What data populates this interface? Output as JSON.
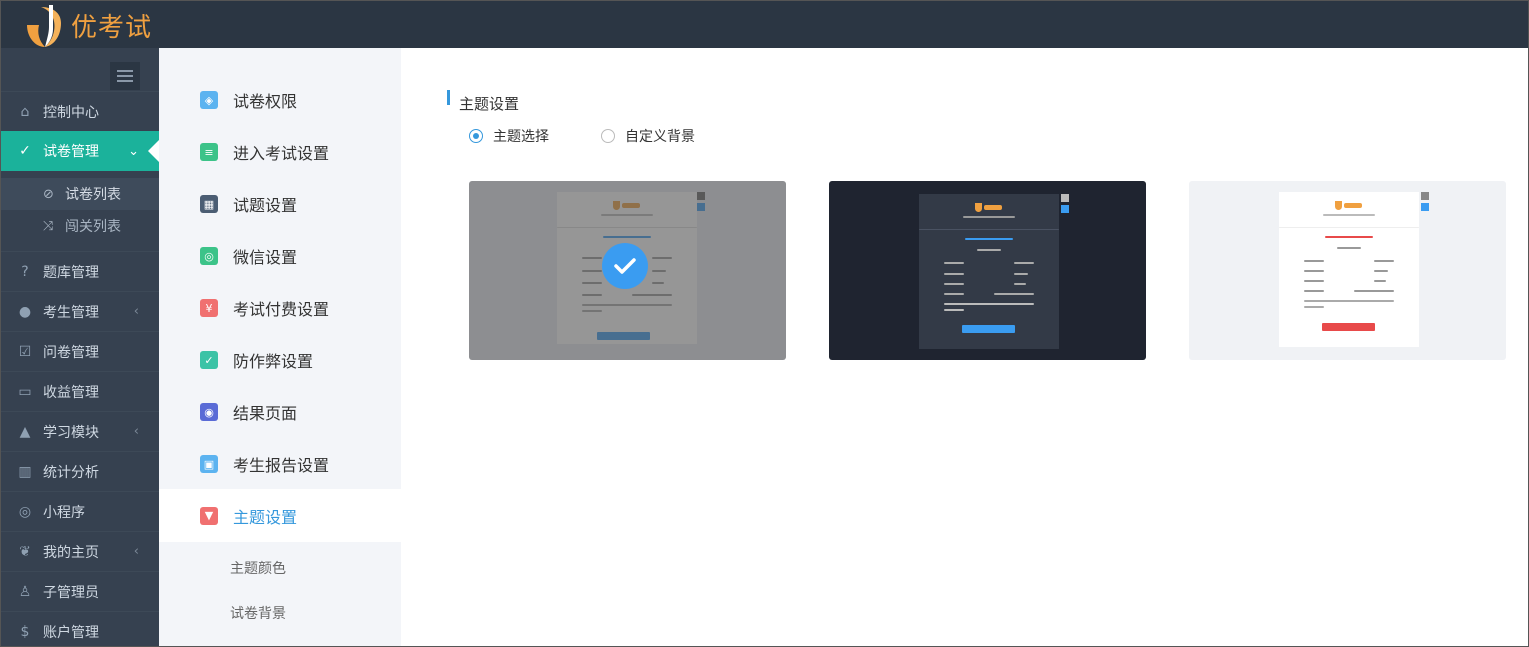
{
  "app": {
    "name": "优考试"
  },
  "sidebar": {
    "toggle_icon": "hamburger-icon",
    "items": [
      {
        "label": "控制中心",
        "icon": "home-icon"
      },
      {
        "label": "试卷管理",
        "icon": "check-circle-icon",
        "active": true
      },
      {
        "label": "题库管理",
        "icon": "question-circle-icon"
      },
      {
        "label": "考生管理",
        "icon": "user-icon"
      },
      {
        "label": "问卷管理",
        "icon": "checkbox-icon"
      },
      {
        "label": "收益管理",
        "icon": "credit-card-icon"
      },
      {
        "label": "学习模块",
        "icon": "graduation-cap-icon"
      },
      {
        "label": "统计分析",
        "icon": "bar-chart-icon"
      },
      {
        "label": "小程序",
        "icon": "wechat-icon"
      },
      {
        "label": "我的主页",
        "icon": "leaf-icon"
      },
      {
        "label": "子管理员",
        "icon": "user-lock-icon"
      },
      {
        "label": "账户管理",
        "icon": "dollar-icon"
      }
    ],
    "sub_items": [
      {
        "label": "试卷列表",
        "icon": "check-circle-icon",
        "selected": true
      },
      {
        "label": "闯关列表",
        "icon": "shuffle-icon"
      }
    ]
  },
  "settings_nav": {
    "items": [
      {
        "label": "试卷权限",
        "icon": "shield-icon",
        "color": "#5cb3f0"
      },
      {
        "label": "进入考试设置",
        "icon": "list-icon",
        "color": "#3cc389"
      },
      {
        "label": "试题设置",
        "icon": "calendar-icon",
        "color": "#4b5d73"
      },
      {
        "label": "微信设置",
        "icon": "wechat-icon",
        "color": "#3cc389"
      },
      {
        "label": "考试付费设置",
        "icon": "yen-icon",
        "color": "#f07070"
      },
      {
        "label": "防作弊设置",
        "icon": "shield-check-icon",
        "color": "#3cc3a6"
      },
      {
        "label": "结果页面",
        "icon": "eye-icon",
        "color": "#5a6bd6"
      },
      {
        "label": "考生报告设置",
        "icon": "report-icon",
        "color": "#5cb3f0"
      },
      {
        "label": "主题设置",
        "icon": "shirt-icon",
        "color": "#f07070",
        "active": true
      }
    ],
    "sub_items": [
      {
        "label": "主题颜色"
      },
      {
        "label": "试卷背景"
      }
    ]
  },
  "theme_section": {
    "title": "主题设置",
    "radio_options": [
      {
        "label": "主题选择",
        "checked": true
      },
      {
        "label": "自定义背景",
        "checked": false
      }
    ],
    "themes": [
      {
        "name": "blue",
        "selected": true
      },
      {
        "name": "dark",
        "selected": false
      },
      {
        "name": "red",
        "selected": false
      }
    ]
  },
  "colors": {
    "topbar": "#2b3643",
    "sidebar": "#364150",
    "accent_green": "#1bb29b",
    "accent_blue": "#3598dc",
    "logo_orange": "#f0a040"
  }
}
